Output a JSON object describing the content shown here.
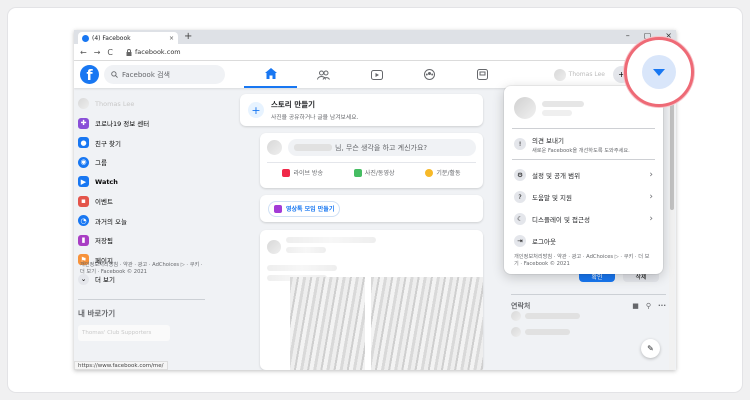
{
  "browser": {
    "tab_title": "(4) Facebook",
    "tab_close": "×",
    "new_tab": "+",
    "win_controls": [
      "–",
      "▢",
      "×"
    ],
    "back": "←",
    "forward": "→",
    "reload": "C",
    "url": "facebook.com",
    "status_url": "https://www.facebook.com/me/"
  },
  "header": {
    "logo_letter": "f",
    "search_placeholder": "Facebook 검색",
    "profile_label": "Thomas Lee",
    "create_label": "+",
    "messenger_label": "◉"
  },
  "sidebar": {
    "profile_name": "Thomas Lee",
    "items": [
      {
        "label": "코로나19 정보 센터",
        "color": "#8a4fd8"
      },
      {
        "label": "친구 찾기",
        "color": "#1877f2"
      },
      {
        "label": "그룹",
        "color": "#1877f2"
      },
      {
        "label": "Watch",
        "color": "#1877f2"
      },
      {
        "label": "이벤트",
        "color": "#e4554b"
      },
      {
        "label": "과거의 오늘",
        "color": "#1877f2"
      },
      {
        "label": "저장됨",
        "color": "#a93ec4"
      },
      {
        "label": "페이지",
        "color": "#f7923a"
      },
      {
        "label": "더 보기",
        "color": "#e4e6eb"
      }
    ],
    "shortcuts_title": "내 바로가기",
    "shortcut_item": "Thomas' Club Supporters",
    "footer": "개인정보처리방침 · 약관 · 광고 · AdChoices ▷ · 쿠키 · 더 보기 · Facebook © 2021"
  },
  "story": {
    "title": "스토리 만들기",
    "subtitle": "사진을 공유하거나 글을 남겨보세요."
  },
  "composer": {
    "prompt": "님, 무슨 생각을 하고 계신가요?",
    "actions": [
      {
        "label": "라이브 방송",
        "color": "#f02849"
      },
      {
        "label": "사진/동영상",
        "color": "#45bd62"
      },
      {
        "label": "기분/활동",
        "color": "#f7b928"
      }
    ]
  },
  "rooms": {
    "label": "영상톡 모임 만들기",
    "color": "#a33bd6"
  },
  "right": {
    "confirm_label": "확인",
    "delete_label": "삭제",
    "contacts_title": "연락처",
    "new_message": "✎"
  },
  "menu": {
    "feedback_title": "의견 보내기",
    "feedback_sub": "새로운 Facebook을 개선하도록 도와주세요.",
    "items": [
      {
        "label": "설정 및 공개 범위",
        "icon": "gear-icon",
        "glyph": "⚙"
      },
      {
        "label": "도움말 및 지원",
        "icon": "help-icon",
        "glyph": "?"
      },
      {
        "label": "디스플레이 및 접근성",
        "icon": "moon-icon",
        "glyph": "☾"
      }
    ],
    "logout": "로그아웃",
    "footer": "개인정보처리방침 · 약관 · 광고 · AdChoices ▷ · 쿠키 · 더 보기 · Facebook © 2021"
  },
  "colors": {
    "brand": "#1877f2",
    "highlight_ring": "#ee6a76"
  }
}
